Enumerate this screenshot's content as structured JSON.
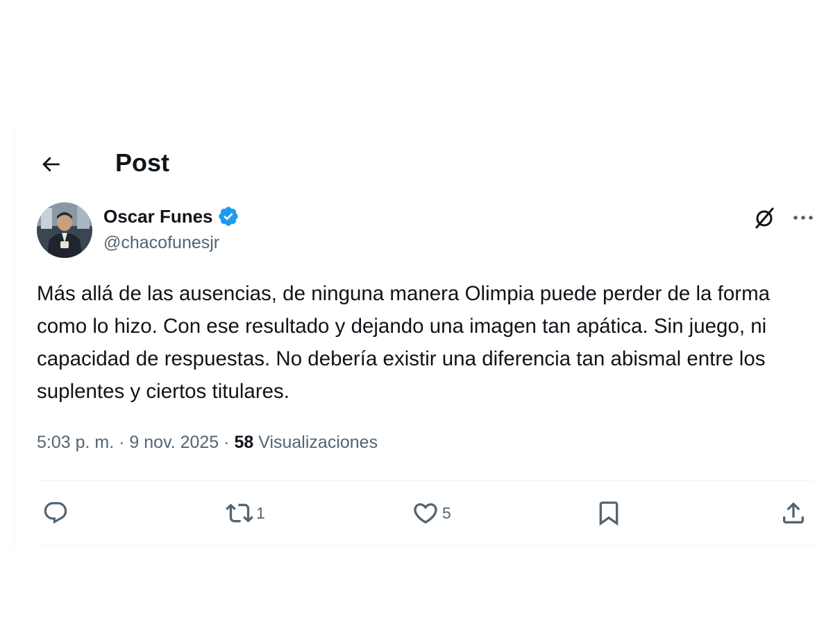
{
  "header": {
    "title": "Post"
  },
  "author": {
    "display_name": "Oscar Funes",
    "handle": "@chacofunesjr",
    "verified": true
  },
  "post": {
    "text": "Más allá de las ausencias, de ninguna manera Olimpia puede perder de la forma como lo hizo. Con ese resultado y dejando una imagen tan apática. Sin juego, ni capacidad de respuestas. No debería existir una diferencia tan abismal entre los suplentes y ciertos titulares.",
    "time": "5:03 p. m.",
    "date": "9 nov. 2025",
    "views_count": "58",
    "views_label": "Visualizaciones",
    "separator": "·"
  },
  "actions": {
    "reply_count": "",
    "repost_count": "1",
    "like_count": "5"
  },
  "icons": {
    "back": "arrow-left-icon",
    "verified": "verified-badge-icon",
    "grok": "grok-icon",
    "more": "more-horizontal-icon",
    "reply": "reply-bubble-icon",
    "repost": "repost-icon",
    "like": "heart-icon",
    "bookmark": "bookmark-icon",
    "share": "share-icon"
  },
  "colors": {
    "text_primary": "#0f1419",
    "text_secondary": "#536471",
    "verified_blue": "#1d9bf0",
    "divider": "#eff3f4"
  }
}
